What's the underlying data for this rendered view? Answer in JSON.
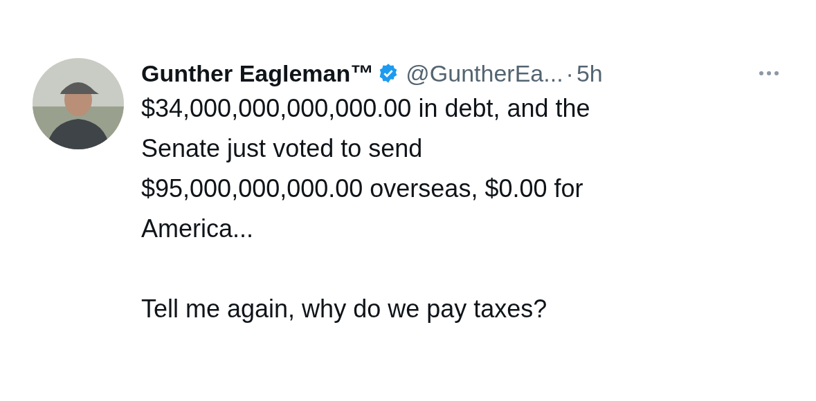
{
  "tweet": {
    "author": {
      "name": "Gunther Eagleman™",
      "verified": true,
      "handle": "@GuntherEa...",
      "separator": "·",
      "time": "5h"
    },
    "paragraphs": [
      "$34,000,000,000,000.00 in debt,  and the\nSenate just voted to send\n$95,000,000,000.00 overseas, $0.00 for\nAmerica...",
      "Tell me again,  why do we pay taxes?"
    ]
  }
}
